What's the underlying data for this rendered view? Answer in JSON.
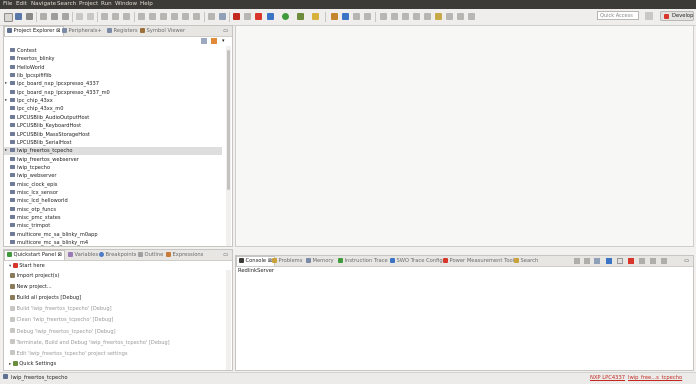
{
  "menu": [
    "File",
    "Edit",
    "Navigate",
    "Search",
    "Project",
    "Run",
    "Window",
    "Help"
  ],
  "quick_access_placeholder": "Quick Access",
  "perspective": "Develop",
  "left_tabs": {
    "project_explorer": "Project Explorer",
    "peripherals": "Peripherals+",
    "registers": "Registers",
    "symbol_viewer": "Symbol Viewer"
  },
  "projects": [
    {
      "name": "Contest",
      "expandable": false
    },
    {
      "name": "freertos_blinky",
      "expandable": false
    },
    {
      "name": "HelloWorld",
      "expandable": false
    },
    {
      "name": "lib_lpcspififlib",
      "expandable": false
    },
    {
      "name": "lpc_board_nxp_lpcxpresso_4337",
      "expandable": true
    },
    {
      "name": "lpc_board_nxp_lpcxpresso_4337_m0",
      "expandable": false
    },
    {
      "name": "lpc_chip_43xx",
      "expandable": true
    },
    {
      "name": "lpc_chip_43xx_m0",
      "expandable": false
    },
    {
      "name": "LPCUSBlib_AudioOutputHost",
      "expandable": false
    },
    {
      "name": "LPCUSBlib_KeyboardHost",
      "expandable": false
    },
    {
      "name": "LPCUSBlib_MassStorageHost",
      "expandable": false
    },
    {
      "name": "LPCUSBlib_SerialHost",
      "expandable": false
    },
    {
      "name": "lwip_freertos_tcpecho",
      "expandable": true,
      "selected": true
    },
    {
      "name": "lwip_freertos_webserver",
      "expandable": false
    },
    {
      "name": "lwip_tcpecho",
      "expandable": false
    },
    {
      "name": "lwip_webserver",
      "expandable": false
    },
    {
      "name": "misc_clock_epis",
      "expandable": false
    },
    {
      "name": "misc_lcx_sensor",
      "expandable": false
    },
    {
      "name": "misc_lcd_helloworld",
      "expandable": false
    },
    {
      "name": "misc_otp_funcs",
      "expandable": false
    },
    {
      "name": "misc_pmc_states",
      "expandable": false
    },
    {
      "name": "misc_trimpot",
      "expandable": false
    },
    {
      "name": "multicore_mc_sa_blinky_m0app",
      "expandable": false
    },
    {
      "name": "multicore_mc_sa_blinky_m4",
      "expandable": false
    }
  ],
  "bottom_left_tabs": {
    "quickstart": "Quickstart Panel",
    "variables": "Variables",
    "breakpoints": "Breakpoints",
    "outline": "Outline",
    "expressions": "Expressions"
  },
  "quickstart": {
    "start_here": "Start here",
    "items": [
      {
        "label": "Import project(s)",
        "enabled": true
      },
      {
        "label": "New project...",
        "enabled": true
      },
      {
        "label": "Build all projects [Debug]",
        "enabled": true
      },
      {
        "label": "Build 'lwip_freertos_tcpecho' [Debug]",
        "enabled": false
      },
      {
        "label": "Clean 'lwip_freertos_tcpecho' [Debug]",
        "enabled": false
      },
      {
        "label": "Debug 'lwip_freertos_tcpecho' [Debug]",
        "enabled": false
      },
      {
        "label": "Terminate, Build and Debug 'lwip_freertos_tcpecho' [Debug]",
        "enabled": false
      },
      {
        "label": "Edit 'lwip_freertos_tcpecho' project settings",
        "enabled": false
      }
    ],
    "quick_settings": "Quick Settings"
  },
  "console_tabs": {
    "console": "Console",
    "problems": "Problems",
    "memory": "Memory",
    "instruction_trace": "Instruction Trace",
    "swo": "SWO Trace Config",
    "power": "Power Measurement Tool",
    "search": "Search"
  },
  "console_text": "RedlinkServer",
  "status": {
    "left": "lwip_freertos_tcpecho",
    "chip": "NXP LPC4337",
    "project": "lwip_free...s_tcpecho"
  }
}
